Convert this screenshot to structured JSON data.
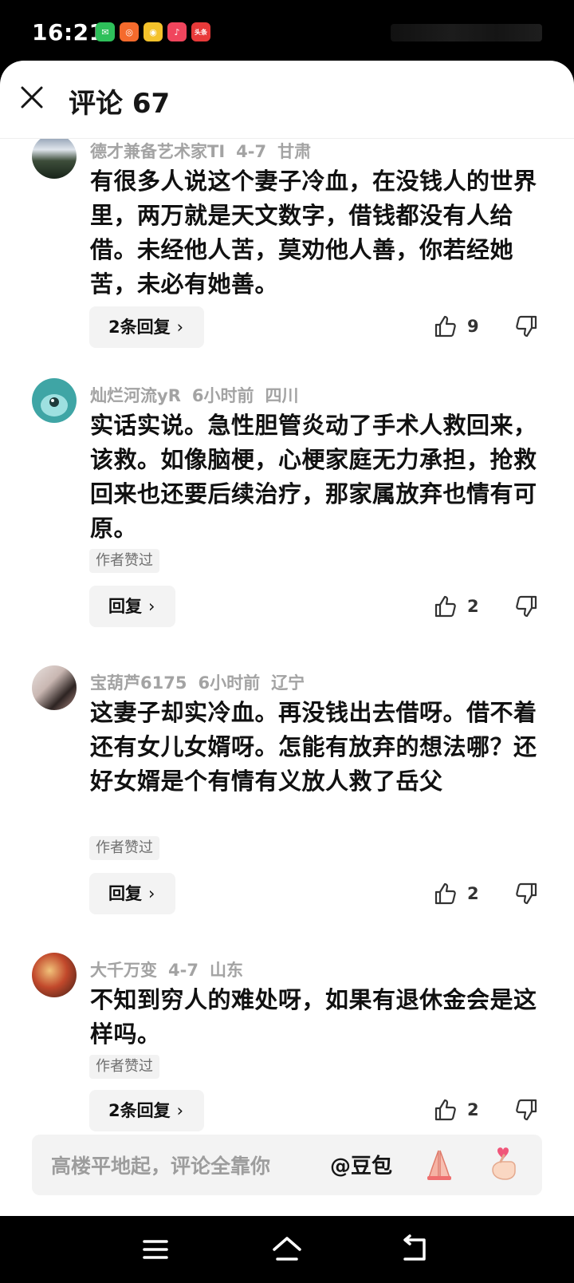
{
  "status_bar": {
    "time": "16:21",
    "app_icons": [
      {
        "name": "wechat-icon",
        "color": "#2ec05a",
        "glyph": "✉"
      },
      {
        "name": "app-orange-icon",
        "color": "#f56a2c",
        "glyph": "◎"
      },
      {
        "name": "app-yellow-icon",
        "color": "#f4c22b",
        "glyph": "◉"
      },
      {
        "name": "douyin-icon",
        "color": "#f0455d",
        "glyph": "♪"
      },
      {
        "name": "toutiao-icon",
        "color": "#e83a3a",
        "glyph": "头条"
      }
    ]
  },
  "header": {
    "title": "评论 67"
  },
  "comments": [
    {
      "username": "德才兼备艺术家TI",
      "time": "4-7",
      "location": "甘肃",
      "text": "有很多人说这个妻子冷血，在没钱人的世界里，两万就是天文数字，借钱都没有人给借。未经他人苦，莫劝他人善，你若经她苦，未必有她善。",
      "author_liked": null,
      "reply_label": "2条回复",
      "likes": "9"
    },
    {
      "username": "灿烂河流yR",
      "time": "6小时前",
      "location": "四川",
      "text": "实话实说。急性胆管炎动了手术人救回来，该救。如像脑梗，心梗家庭无力承担，抢救回来也还要后续治疗，那家属放弃也情有可原。",
      "author_liked": "作者赞过",
      "reply_label": "回复",
      "likes": "2"
    },
    {
      "username": "宝葫芦6175",
      "time": "6小时前",
      "location": "辽宁",
      "text": "这妻子却实冷血。再没钱出去借呀。借不着还有女儿女婿呀。怎能有放弃的想法哪？还好女婿是个有情有义放人救了岳父",
      "author_liked": "作者赞过",
      "reply_label": "回复",
      "likes": "2"
    },
    {
      "username": "大千万变",
      "time": "4-7",
      "location": "山东",
      "text": "不知到穷人的难处呀，如果有退休金会是这样吗。",
      "author_liked": "作者赞过",
      "reply_label": "2条回复",
      "likes": "2"
    }
  ],
  "input_bar": {
    "placeholder": "高楼平地起，评论全靠你",
    "mention": "@豆包"
  },
  "colors": {
    "meta_gray": "#a3a3a3",
    "text": "#111111",
    "chip_bg": "#f3f3f3"
  }
}
